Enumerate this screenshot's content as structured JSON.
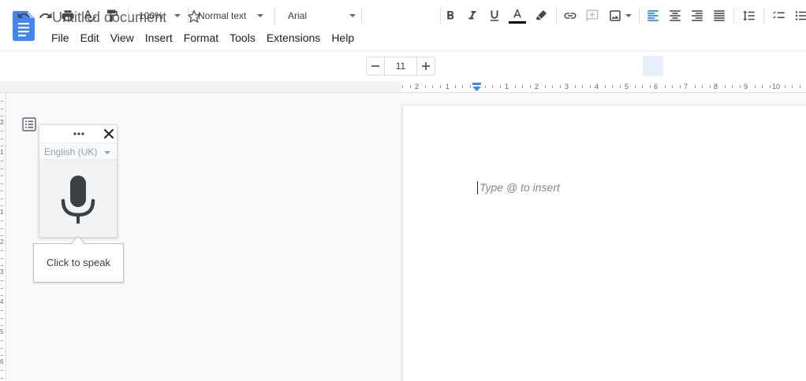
{
  "document": {
    "title": "Untitled document"
  },
  "menu": [
    "File",
    "Edit",
    "View",
    "Insert",
    "Format",
    "Tools",
    "Extensions",
    "Help"
  ],
  "toolbar": {
    "zoom": "100%",
    "style": "Normal text",
    "font": "Arial",
    "font_size": "11",
    "icons": [
      "undo-icon",
      "redo-icon",
      "print-icon",
      "spellcheck-icon",
      "paint-format-icon",
      "bold-icon",
      "italic-icon",
      "underline-icon",
      "text-color-icon",
      "highlight-icon",
      "link-icon",
      "comment-icon",
      "image-icon",
      "align-left-icon",
      "align-center-icon",
      "align-right-icon",
      "justify-icon",
      "line-spacing-icon",
      "checklist-icon",
      "bulleted-list-icon"
    ]
  },
  "ruler": {
    "numbers": [
      "2",
      "1",
      "1",
      "2",
      "3",
      "4",
      "5",
      "6",
      "7",
      "8",
      "9",
      "10"
    ]
  },
  "vruler": {
    "numbers": [
      "2",
      "1",
      "1",
      "2",
      "3",
      "4",
      "5",
      "6"
    ]
  },
  "editor": {
    "placeholder": "Type @ to insert"
  },
  "voice_typing": {
    "language": "English (UK)",
    "tooltip": "Click to speak"
  },
  "colors": {
    "accent": "#1a73e8",
    "logo_blue": "#4285f4",
    "text_color_bar": "#000000"
  }
}
